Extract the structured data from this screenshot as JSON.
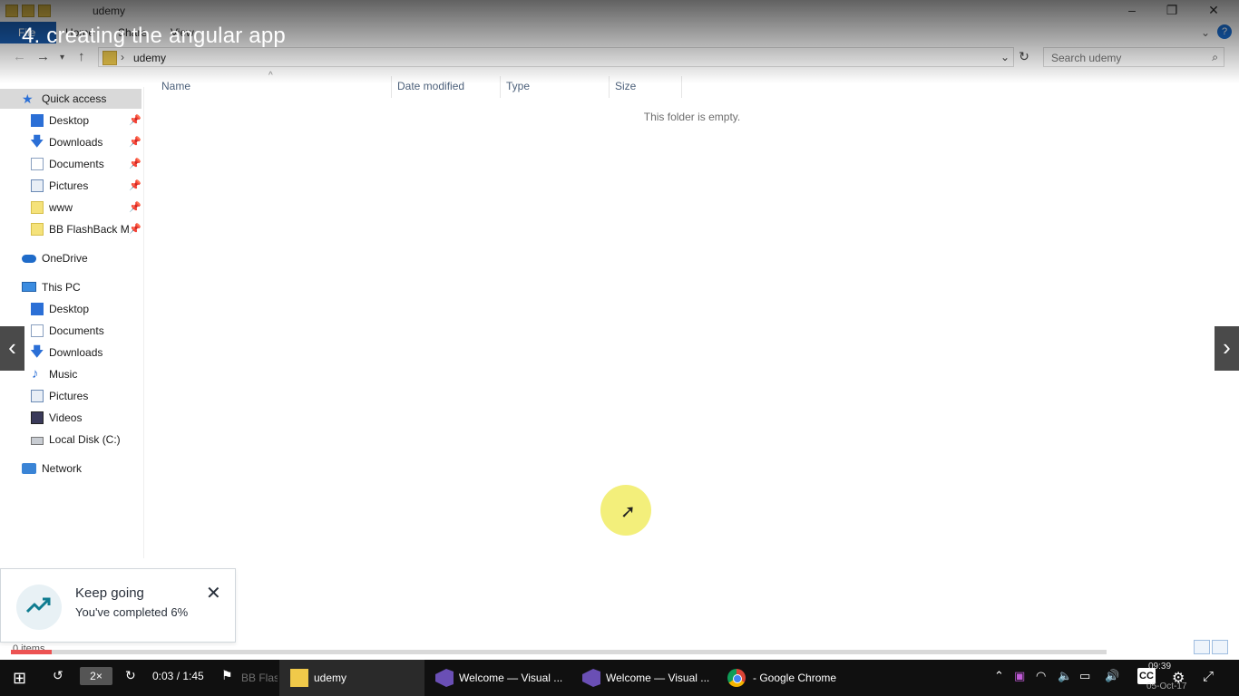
{
  "video": {
    "title": "4. creating the angular app",
    "speed": "2×",
    "timecode": "0:03 / 1:45",
    "progress_fraction": 0.037
  },
  "window": {
    "caption": "udemy"
  },
  "ribbon": {
    "file": "File",
    "tabs": [
      "Home",
      "Share",
      "View"
    ],
    "help": "?"
  },
  "address": {
    "path": "udemy",
    "search_placeholder": "Search udemy"
  },
  "nav": {
    "quick_access": "Quick access",
    "quick_items": [
      "Desktop",
      "Downloads",
      "Documents",
      "Pictures",
      "www",
      "BB FlashBack Mo"
    ],
    "onedrive": "OneDrive",
    "this_pc": "This PC",
    "pc_items": [
      "Desktop",
      "Documents",
      "Downloads",
      "Music",
      "Pictures",
      "Videos",
      "Local Disk (C:)"
    ],
    "network": "Network"
  },
  "columns": [
    "Name",
    "Date modified",
    "Type",
    "Size"
  ],
  "empty_message": "This folder is empty.",
  "status": {
    "items": "0 items"
  },
  "toast": {
    "title": "Keep going",
    "body": "You've completed 6%"
  },
  "taskbar": {
    "apps": [
      {
        "label": "BB FlashBack Compas...",
        "icon": "recorder-icon"
      },
      {
        "label": "udemy",
        "icon": "folder-icon"
      },
      {
        "label": "Welcome — Visual ...",
        "icon": "vscode-icon"
      },
      {
        "label": "Welcome — Visual ...",
        "icon": "vscode-icon"
      },
      {
        "label": "- Google Chrome",
        "icon": "chrome-icon"
      }
    ],
    "cc": "CC",
    "clock_time": "09:39",
    "clock_date": "05-Oct-17"
  },
  "colors": {
    "progress": "#ec5252",
    "file_tab": "#1a5fb4",
    "highlight": "#f3ef7b"
  }
}
